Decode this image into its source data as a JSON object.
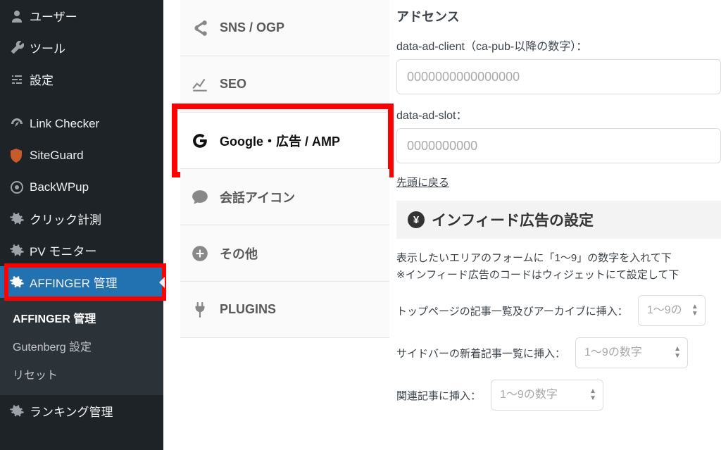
{
  "sidebar": {
    "items": [
      {
        "label": "ユーザー",
        "icon": "user-icon"
      },
      {
        "label": "ツール",
        "icon": "wrench-icon"
      },
      {
        "label": "設定",
        "icon": "sliders-icon"
      },
      {
        "label": "Link Checker",
        "icon": "dashboard-icon"
      },
      {
        "label": "SiteGuard",
        "icon": "shield-icon"
      },
      {
        "label": "BackWPup",
        "icon": "target-icon"
      },
      {
        "label": "クリック計測",
        "icon": "gear-icon"
      },
      {
        "label": "PV モニター",
        "icon": "gear-icon"
      },
      {
        "label": "AFFINGER 管理",
        "icon": "gear-icon",
        "active": true,
        "highlight": true
      },
      {
        "label": "ランキング管理",
        "icon": "gear-icon"
      }
    ],
    "submenu": [
      {
        "label": "AFFINGER 管理",
        "bold": true
      },
      {
        "label": "Gutenberg 設定"
      },
      {
        "label": "リセット"
      }
    ]
  },
  "tabs": [
    {
      "label": "SNS / OGP",
      "icon": "share-icon"
    },
    {
      "label": "SEO",
      "icon": "line-chart-icon"
    },
    {
      "label": "Google・広告 / AMP",
      "icon": "google-icon",
      "selected": true,
      "highlight": true
    },
    {
      "label": "会話アイコン",
      "icon": "speech-icon"
    },
    {
      "label": "その他",
      "icon": "plus-circle-icon"
    },
    {
      "label": "PLUGINS",
      "icon": "plug-icon"
    }
  ],
  "content": {
    "adsense_heading": "アドセンス",
    "ad_client_label": "data-ad-client（ca-pub-以降の数字）：",
    "ad_client_placeholder": "0000000000000000",
    "ad_slot_label": "data-ad-slot：",
    "ad_slot_placeholder": "0000000000",
    "back_to_top": "先頭に戻る",
    "infeed_heading": "インフィード広告の設定",
    "infeed_desc_line1": "表示したいエリアのフォームに「1〜9」の数字を入れて下",
    "infeed_desc_line2": "※インフィード広告のコードはウィジェットにて設定して下",
    "placement1_label": "トップページの記事一覧及びアーカイブに挿入：",
    "placement1_placeholder": "1〜9の",
    "placement2_label": "サイドバーの新着記事一覧に挿入：",
    "placement2_placeholder": "1〜9の数字",
    "placement3_label": "関連記事に挿入：",
    "placement3_placeholder": "1〜9の数字"
  }
}
